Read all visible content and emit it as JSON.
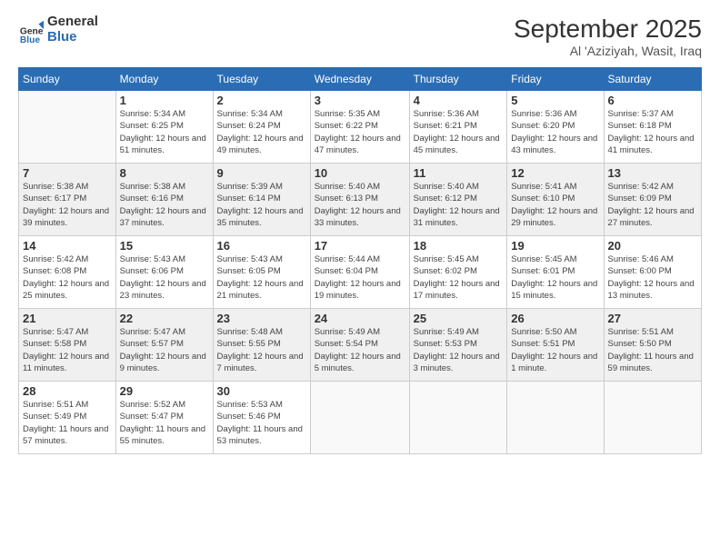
{
  "logo": {
    "general": "General",
    "blue": "Blue"
  },
  "header": {
    "month": "September 2025",
    "location": "Al 'Aziziyah, Wasit, Iraq"
  },
  "weekdays": [
    "Sunday",
    "Monday",
    "Tuesday",
    "Wednesday",
    "Thursday",
    "Friday",
    "Saturday"
  ],
  "weeks": [
    [
      {
        "day": "",
        "sunrise": "",
        "sunset": "",
        "daylight": ""
      },
      {
        "day": "1",
        "sunrise": "Sunrise: 5:34 AM",
        "sunset": "Sunset: 6:25 PM",
        "daylight": "Daylight: 12 hours and 51 minutes."
      },
      {
        "day": "2",
        "sunrise": "Sunrise: 5:34 AM",
        "sunset": "Sunset: 6:24 PM",
        "daylight": "Daylight: 12 hours and 49 minutes."
      },
      {
        "day": "3",
        "sunrise": "Sunrise: 5:35 AM",
        "sunset": "Sunset: 6:22 PM",
        "daylight": "Daylight: 12 hours and 47 minutes."
      },
      {
        "day": "4",
        "sunrise": "Sunrise: 5:36 AM",
        "sunset": "Sunset: 6:21 PM",
        "daylight": "Daylight: 12 hours and 45 minutes."
      },
      {
        "day": "5",
        "sunrise": "Sunrise: 5:36 AM",
        "sunset": "Sunset: 6:20 PM",
        "daylight": "Daylight: 12 hours and 43 minutes."
      },
      {
        "day": "6",
        "sunrise": "Sunrise: 5:37 AM",
        "sunset": "Sunset: 6:18 PM",
        "daylight": "Daylight: 12 hours and 41 minutes."
      }
    ],
    [
      {
        "day": "7",
        "sunrise": "Sunrise: 5:38 AM",
        "sunset": "Sunset: 6:17 PM",
        "daylight": "Daylight: 12 hours and 39 minutes."
      },
      {
        "day": "8",
        "sunrise": "Sunrise: 5:38 AM",
        "sunset": "Sunset: 6:16 PM",
        "daylight": "Daylight: 12 hours and 37 minutes."
      },
      {
        "day": "9",
        "sunrise": "Sunrise: 5:39 AM",
        "sunset": "Sunset: 6:14 PM",
        "daylight": "Daylight: 12 hours and 35 minutes."
      },
      {
        "day": "10",
        "sunrise": "Sunrise: 5:40 AM",
        "sunset": "Sunset: 6:13 PM",
        "daylight": "Daylight: 12 hours and 33 minutes."
      },
      {
        "day": "11",
        "sunrise": "Sunrise: 5:40 AM",
        "sunset": "Sunset: 6:12 PM",
        "daylight": "Daylight: 12 hours and 31 minutes."
      },
      {
        "day": "12",
        "sunrise": "Sunrise: 5:41 AM",
        "sunset": "Sunset: 6:10 PM",
        "daylight": "Daylight: 12 hours and 29 minutes."
      },
      {
        "day": "13",
        "sunrise": "Sunrise: 5:42 AM",
        "sunset": "Sunset: 6:09 PM",
        "daylight": "Daylight: 12 hours and 27 minutes."
      }
    ],
    [
      {
        "day": "14",
        "sunrise": "Sunrise: 5:42 AM",
        "sunset": "Sunset: 6:08 PM",
        "daylight": "Daylight: 12 hours and 25 minutes."
      },
      {
        "day": "15",
        "sunrise": "Sunrise: 5:43 AM",
        "sunset": "Sunset: 6:06 PM",
        "daylight": "Daylight: 12 hours and 23 minutes."
      },
      {
        "day": "16",
        "sunrise": "Sunrise: 5:43 AM",
        "sunset": "Sunset: 6:05 PM",
        "daylight": "Daylight: 12 hours and 21 minutes."
      },
      {
        "day": "17",
        "sunrise": "Sunrise: 5:44 AM",
        "sunset": "Sunset: 6:04 PM",
        "daylight": "Daylight: 12 hours and 19 minutes."
      },
      {
        "day": "18",
        "sunrise": "Sunrise: 5:45 AM",
        "sunset": "Sunset: 6:02 PM",
        "daylight": "Daylight: 12 hours and 17 minutes."
      },
      {
        "day": "19",
        "sunrise": "Sunrise: 5:45 AM",
        "sunset": "Sunset: 6:01 PM",
        "daylight": "Daylight: 12 hours and 15 minutes."
      },
      {
        "day": "20",
        "sunrise": "Sunrise: 5:46 AM",
        "sunset": "Sunset: 6:00 PM",
        "daylight": "Daylight: 12 hours and 13 minutes."
      }
    ],
    [
      {
        "day": "21",
        "sunrise": "Sunrise: 5:47 AM",
        "sunset": "Sunset: 5:58 PM",
        "daylight": "Daylight: 12 hours and 11 minutes."
      },
      {
        "day": "22",
        "sunrise": "Sunrise: 5:47 AM",
        "sunset": "Sunset: 5:57 PM",
        "daylight": "Daylight: 12 hours and 9 minutes."
      },
      {
        "day": "23",
        "sunrise": "Sunrise: 5:48 AM",
        "sunset": "Sunset: 5:55 PM",
        "daylight": "Daylight: 12 hours and 7 minutes."
      },
      {
        "day": "24",
        "sunrise": "Sunrise: 5:49 AM",
        "sunset": "Sunset: 5:54 PM",
        "daylight": "Daylight: 12 hours and 5 minutes."
      },
      {
        "day": "25",
        "sunrise": "Sunrise: 5:49 AM",
        "sunset": "Sunset: 5:53 PM",
        "daylight": "Daylight: 12 hours and 3 minutes."
      },
      {
        "day": "26",
        "sunrise": "Sunrise: 5:50 AM",
        "sunset": "Sunset: 5:51 PM",
        "daylight": "Daylight: 12 hours and 1 minute."
      },
      {
        "day": "27",
        "sunrise": "Sunrise: 5:51 AM",
        "sunset": "Sunset: 5:50 PM",
        "daylight": "Daylight: 11 hours and 59 minutes."
      }
    ],
    [
      {
        "day": "28",
        "sunrise": "Sunrise: 5:51 AM",
        "sunset": "Sunset: 5:49 PM",
        "daylight": "Daylight: 11 hours and 57 minutes."
      },
      {
        "day": "29",
        "sunrise": "Sunrise: 5:52 AM",
        "sunset": "Sunset: 5:47 PM",
        "daylight": "Daylight: 11 hours and 55 minutes."
      },
      {
        "day": "30",
        "sunrise": "Sunrise: 5:53 AM",
        "sunset": "Sunset: 5:46 PM",
        "daylight": "Daylight: 11 hours and 53 minutes."
      },
      {
        "day": "",
        "sunrise": "",
        "sunset": "",
        "daylight": ""
      },
      {
        "day": "",
        "sunrise": "",
        "sunset": "",
        "daylight": ""
      },
      {
        "day": "",
        "sunrise": "",
        "sunset": "",
        "daylight": ""
      },
      {
        "day": "",
        "sunrise": "",
        "sunset": "",
        "daylight": ""
      }
    ]
  ]
}
